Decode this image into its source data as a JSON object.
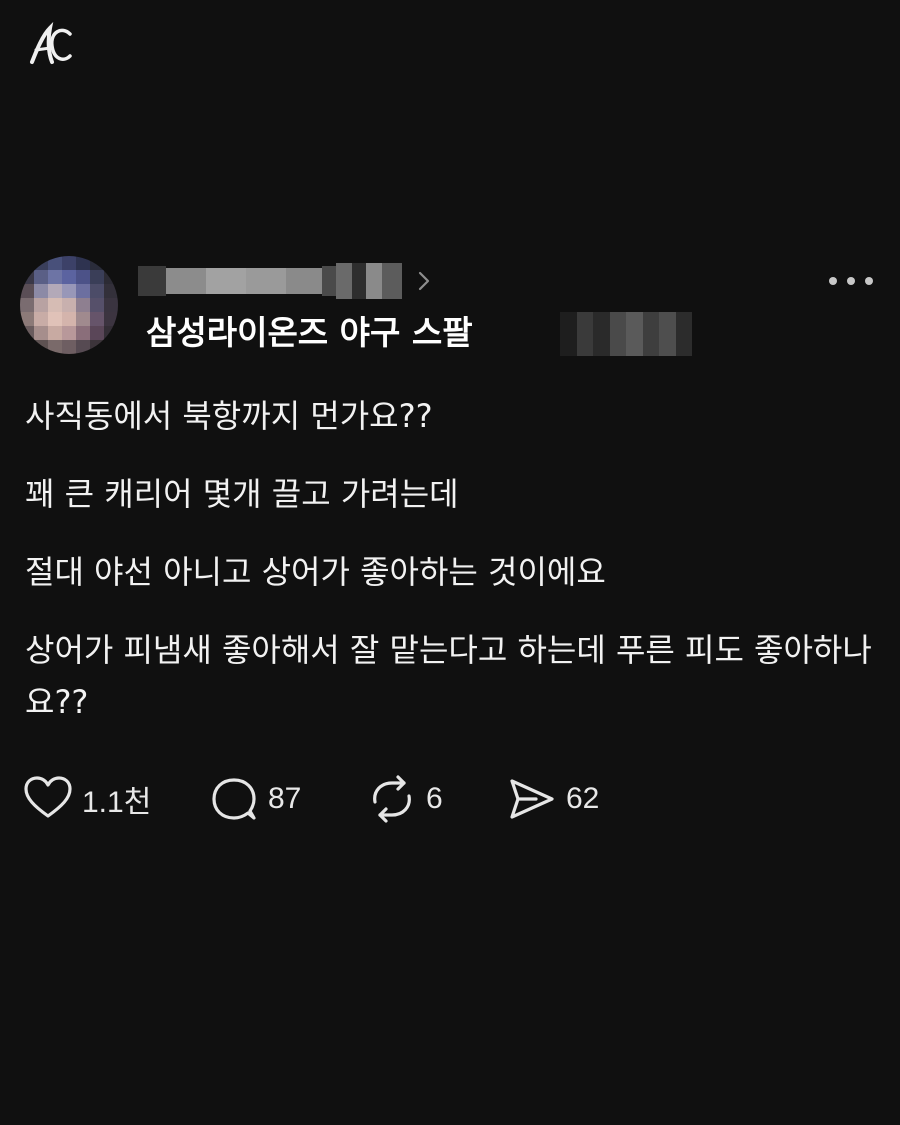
{
  "logo": {
    "icon": "ac-logo-icon"
  },
  "post": {
    "author": {
      "avatar_icon": "blurred-avatar",
      "username_blurred": true,
      "group_name": "삼성라이온즈 야구 스팔",
      "timestamp_blurred": true
    },
    "icons": {
      "chevron": "chevron-right-icon",
      "more": "more-options-icon"
    },
    "paragraphs": [
      "사직동에서 북항까지 먼가요??",
      "꽤 큰 캐리어 몇개 끌고 가려는데",
      "절대 야선 아니고 상어가 좋아하는 것이에요",
      "상어가 피냄새 좋아해서 잘 맡는다고 하는데 푸른 피도 좋아하나요??"
    ],
    "actions": {
      "like": {
        "icon": "heart-icon",
        "count": "1.1천"
      },
      "comment": {
        "icon": "comment-icon",
        "count": "87"
      },
      "repost": {
        "icon": "repost-icon",
        "count": "6"
      },
      "share": {
        "icon": "send-icon",
        "count": "62"
      }
    }
  },
  "colors": {
    "background": "#101010",
    "text": "#f2f2f2",
    "icon": "#e6e6e6"
  }
}
